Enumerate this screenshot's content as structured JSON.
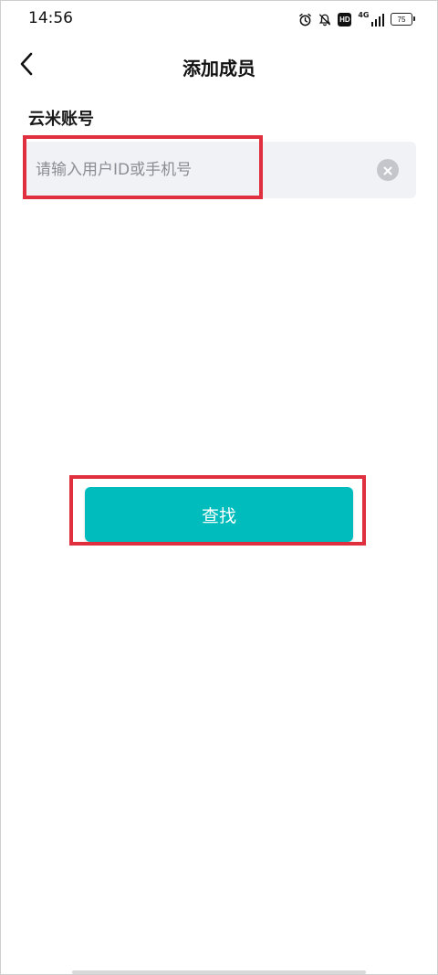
{
  "status_bar": {
    "time": "14:56",
    "network_label": "4G",
    "hd_label": "HD",
    "battery_level": "75",
    "icons": [
      "alarm-icon",
      "bell-muted-icon",
      "hd-icon",
      "signal-icon",
      "battery-icon"
    ]
  },
  "header": {
    "title": "添加成员",
    "back_icon": "chevron-left-icon"
  },
  "form": {
    "account_label": "云米账号",
    "account_input": {
      "value": "",
      "placeholder": "请输入用户ID或手机号"
    },
    "clear_icon": "clear-circle-icon"
  },
  "actions": {
    "find_label": "查找"
  },
  "colors": {
    "accent": "#00bcbc",
    "highlight": "#e0303f",
    "input_bg": "#f1f2f6"
  }
}
